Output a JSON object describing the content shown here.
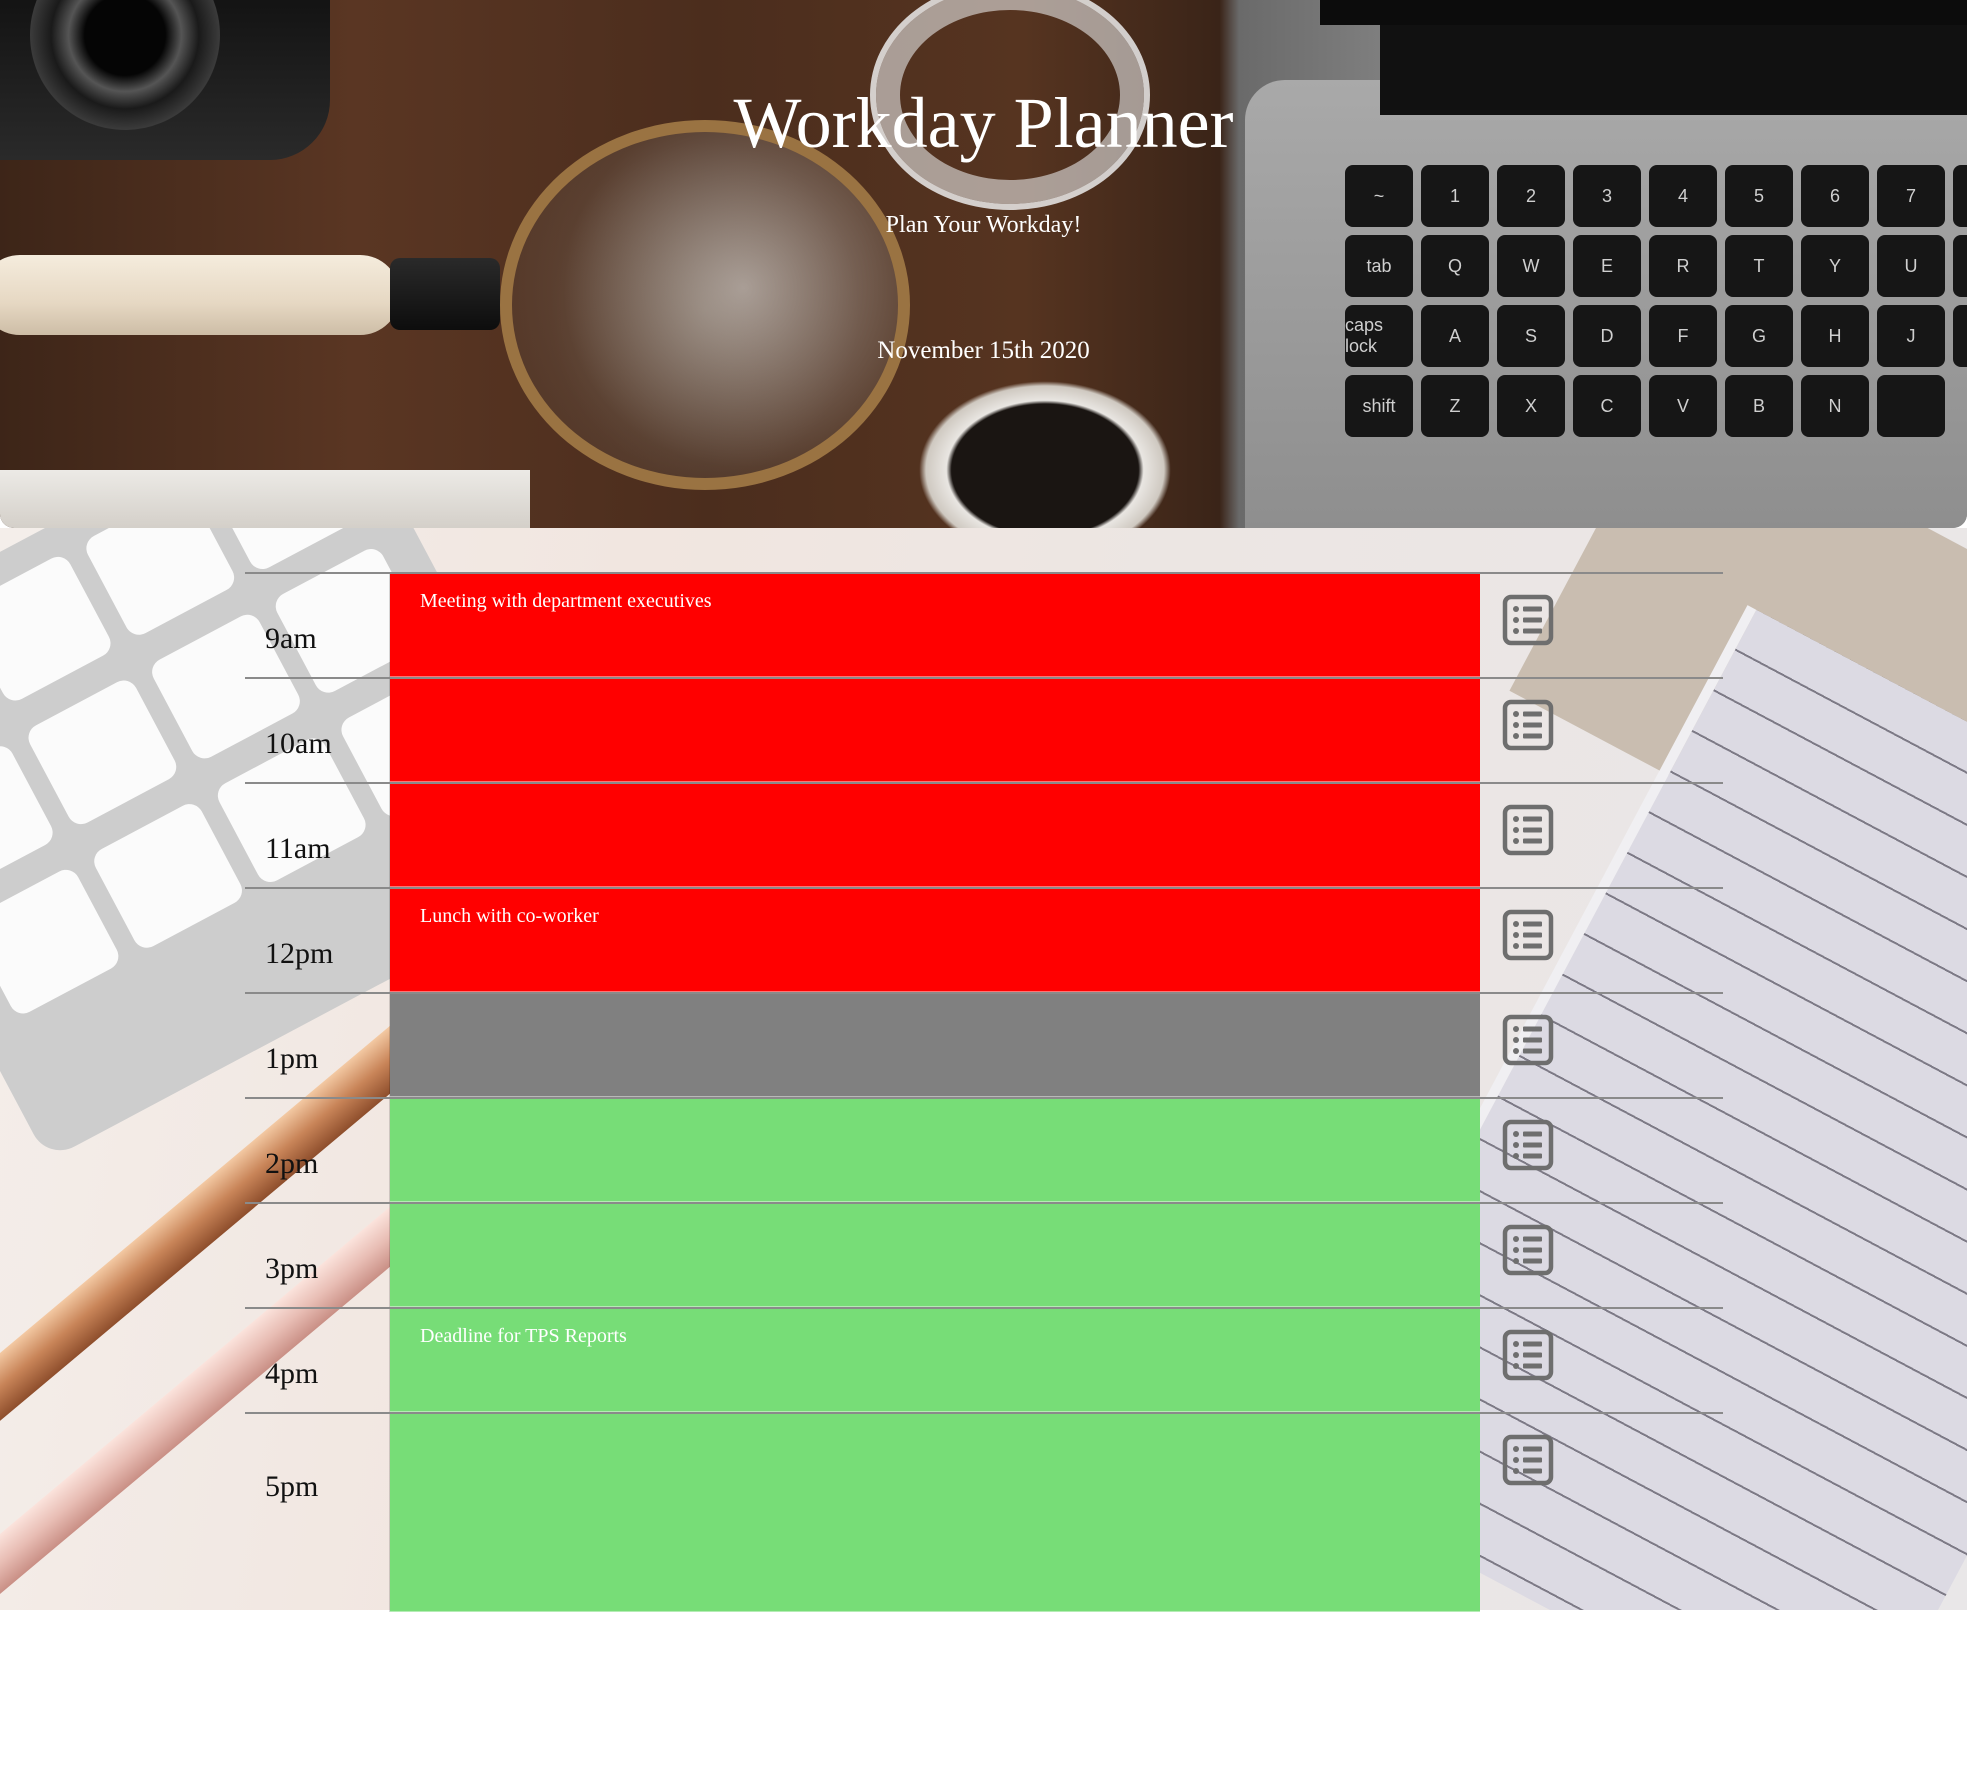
{
  "header": {
    "title": "Workday Planner",
    "subtitle": "Plan Your Workday!",
    "current_date": "November 15th 2020",
    "laptop_keys": [
      "~",
      "1",
      "2",
      "3",
      "4",
      "5",
      "6",
      "7",
      "",
      "tab",
      "Q",
      "W",
      "E",
      "R",
      "T",
      "Y",
      "U",
      "",
      "caps lock",
      "A",
      "S",
      "D",
      "F",
      "G",
      "H",
      "J",
      "",
      "shift",
      "Z",
      "X",
      "C",
      "V",
      "B",
      "N",
      ""
    ]
  },
  "colors": {
    "past": "#ff0000",
    "present": "#808080",
    "future": "#77dd77",
    "save_icon": "#6e6e6e"
  },
  "rows": [
    {
      "hour": "9am",
      "text": "Meeting with department executives",
      "state": "past",
      "save_icon": "list-icon"
    },
    {
      "hour": "10am",
      "text": "",
      "state": "past",
      "save_icon": "list-icon"
    },
    {
      "hour": "11am",
      "text": "",
      "state": "past",
      "save_icon": "list-icon"
    },
    {
      "hour": "12pm",
      "text": "Lunch with co-worker",
      "state": "past",
      "save_icon": "list-icon"
    },
    {
      "hour": "1pm",
      "text": "",
      "state": "present",
      "save_icon": "list-icon"
    },
    {
      "hour": "2pm",
      "text": "",
      "state": "future",
      "save_icon": "list-icon"
    },
    {
      "hour": "3pm",
      "text": "",
      "state": "future",
      "save_icon": "list-icon"
    },
    {
      "hour": "4pm",
      "text": "Deadline for TPS Reports",
      "state": "future",
      "save_icon": "list-icon"
    },
    {
      "hour": "5pm",
      "text": "",
      "state": "future",
      "save_icon": "list-icon"
    }
  ]
}
